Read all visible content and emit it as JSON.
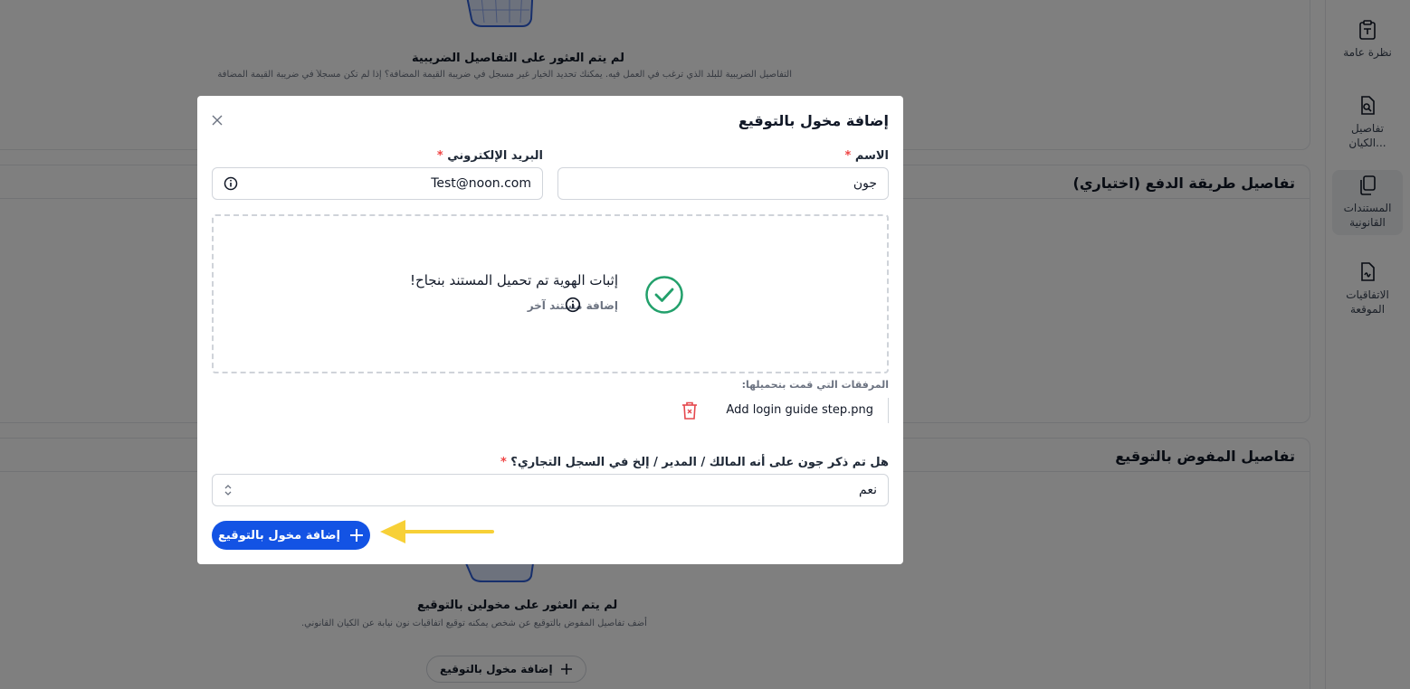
{
  "sidebar": {
    "items": [
      {
        "label": "نظرة عامة",
        "icon": "clipboard-text-icon"
      },
      {
        "label": "تفاصيل الكيان...",
        "icon": "document-search-icon"
      },
      {
        "label": "المستندات القانونية",
        "icon": "documents-copy-icon"
      },
      {
        "label": "الاتفاقيات الموقعة",
        "icon": "document-signed-icon"
      }
    ],
    "active_index": 2
  },
  "background": {
    "tax_section": {
      "empty_title": "لم يتم العثور على التفاصيل الضريبية",
      "empty_desc": "التفاصيل الضريبية للبلد الذي ترغب في العمل فيه. يمكنك تحديد الخيار غير مسجل في ضريبة القيمة المضافة؟ إذا لم تكن مسجلاً في ضريبة القيمة المضافة"
    },
    "payment_section": {
      "title": "تفاصيل طريقة الدفع (اختياري)"
    },
    "signatory_section": {
      "title": "تفاصيل المفوض بالتوقيع",
      "empty_title": "لم يتم العثور على مخولين بالتوقيع",
      "empty_desc": "أضف تفاصيل المفوض بالتوقيع عن شخص يمكنه توقيع اتفاقيات نون نيابة عن الكيان القانوني.",
      "add_button": "إضافة مخول بالتوقيع"
    }
  },
  "modal": {
    "title": "إضافة مخول بالتوقيع",
    "name_label": "الاسم",
    "name_value": "جون",
    "email_label": "البريد الإلكتروني",
    "email_value": "Test@noon.com",
    "required_mark": "*",
    "upload": {
      "success_title": "إثبات الهوية تم تحميل المستند بنجاح!",
      "add_another": "إضافة مستند آخر"
    },
    "attachments_label": "المرفقات التي قمت بتحميلها:",
    "attachments": [
      {
        "name": "Add login guide step.png"
      }
    ],
    "question_label": "هل تم ذكر جون على أنه المالك / المدير / إلخ في السجل التجاري؟",
    "question_value": "نعم",
    "submit_label": "إضافة مخول بالتوقيع"
  },
  "colors": {
    "primary": "#1353e4",
    "success": "#22a06b",
    "danger": "#e5484d",
    "annotation_arrow": "#f7d037"
  }
}
